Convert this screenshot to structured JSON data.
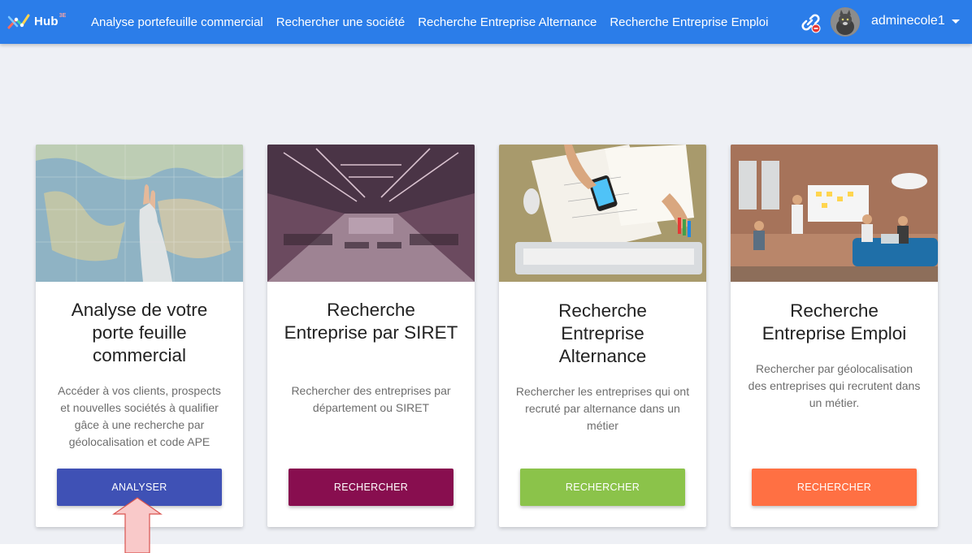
{
  "navbar": {
    "brand": "Hub",
    "brand_sup": "3E",
    "links": [
      "Analyse portefeuille commercial",
      "Rechercher une société",
      "Recherche Entreprise Alternance",
      "Recherche Entreprise Emploi"
    ],
    "user_name": "adminecole1"
  },
  "cards": [
    {
      "title": "Analyse de votre porte feuille commercial",
      "description": "Accéder à vos clients, prospects et nouvelles sociétés à qualifier gâce à une recherche par géolocalisation et code APE",
      "button": "ANALYSER",
      "button_color": "#3f51b5"
    },
    {
      "title": "Recherche Entreprise par SIRET",
      "description": "Rechercher des entreprises par département ou SIRET",
      "button": "RECHERCHER",
      "button_color": "#880e4f"
    },
    {
      "title": "Recherche Entreprise Alternance",
      "description": "Rechercher les entreprises qui ont recruté par alternance dans un métier",
      "button": "RECHERCHER",
      "button_color": "#8bc34a"
    },
    {
      "title": "Recherche Entreprise Emploi",
      "description": "Rechercher par géolocalisation des entreprises qui recrutent dans un métier.",
      "button": "RECHERCHER",
      "button_color": "#ff7043"
    }
  ],
  "icons": {
    "brand": "hub-logo-icon",
    "link": "link-disconnected-icon",
    "avatar": "user-avatar",
    "caret": "caret-down-icon",
    "annotation": "up-arrow-annotation"
  },
  "colors": {
    "navbar": "#2b7de9",
    "background": "#eef0f5",
    "arrow_fill": "#f9c9c9",
    "arrow_stroke": "#d9534f"
  }
}
